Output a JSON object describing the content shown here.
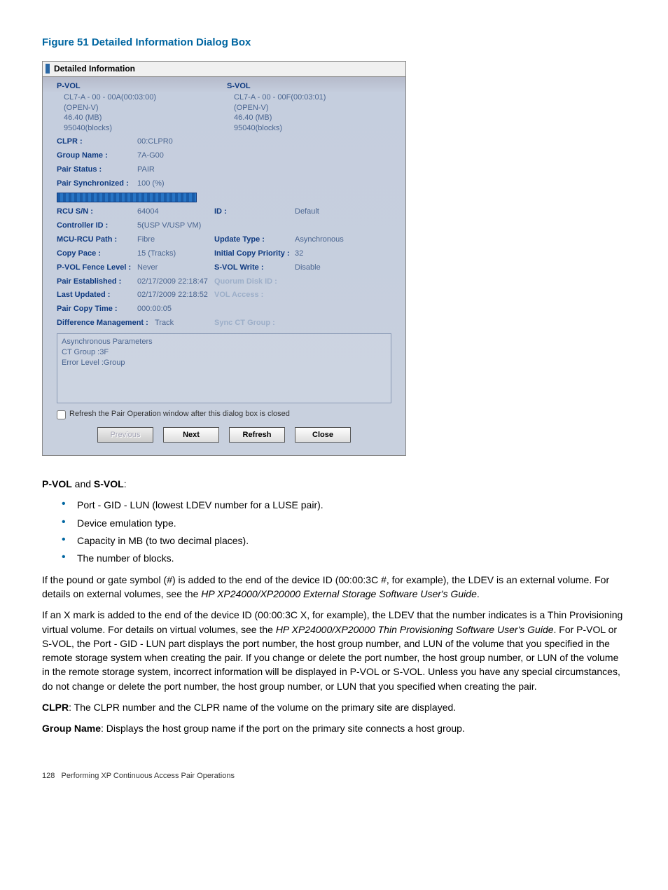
{
  "figure_caption": "Figure 51 Detailed Information Dialog Box",
  "dialog": {
    "title": "Detailed Information",
    "pvol": {
      "label": "P-VOL",
      "line1": "CL7-A - 00 - 00A(00:03:00)",
      "line2": "(OPEN-V)",
      "line3": "46.40 (MB)",
      "line4": "95040(blocks)"
    },
    "svol": {
      "label": "S-VOL",
      "line1": "CL7-A - 00 - 00F(00:03:01)",
      "line2": "(OPEN-V)",
      "line3": "46.40 (MB)",
      "line4": "95040(blocks)"
    },
    "rows": {
      "clpr_label": "CLPR :",
      "clpr_val": "00:CLPR0",
      "group_name_label": "Group Name :",
      "group_name_val": "7A-G00",
      "pair_status_label": "Pair Status :",
      "pair_status_val": "PAIR",
      "pair_sync_label": "Pair Synchronized :",
      "pair_sync_val": "100 (%)",
      "rcu_sn_label": "RCU S/N :",
      "rcu_sn_val": "64004",
      "id_label": "ID :",
      "id_val": "Default",
      "controller_label": "Controller ID :",
      "controller_val": "5(USP V/USP VM)",
      "mcu_rcu_label": "MCU-RCU Path :",
      "mcu_rcu_val": "Fibre",
      "update_type_label": "Update Type :",
      "update_type_val": "Asynchronous",
      "copy_pace_label": "Copy Pace :",
      "copy_pace_val": "15 (Tracks)",
      "initial_copy_label": "Initial Copy Priority :",
      "initial_copy_val": "32",
      "fence_label": "P-VOL Fence Level :",
      "fence_val": "Never",
      "svol_write_label": "S-VOL Write :",
      "svol_write_val": "Disable",
      "pair_est_label": "Pair Established :",
      "pair_est_val": "02/17/2009 22:18:47",
      "quorum_label": "Quorum Disk ID :",
      "last_upd_label": "Last Updated :",
      "last_upd_val": "02/17/2009 22:18:52",
      "vol_access_label": "VOL Access :",
      "pair_copy_label": "Pair Copy Time :",
      "pair_copy_val": "000:00:05",
      "diff_mgmt_label": "Difference Management :",
      "diff_mgmt_val": "Track",
      "sync_ct_label": "Sync CT Group :"
    },
    "async_box": {
      "line1": "Asynchronous Parameters",
      "line2": "CT Group :3F",
      "line3": "Error Level :Group"
    },
    "checkbox_label": "Refresh the Pair Operation window after this dialog box is closed",
    "buttons": {
      "previous": "Previous",
      "next": "Next",
      "refresh": "Refresh",
      "close": "Close"
    }
  },
  "doc": {
    "heading1": "P-VOL",
    "heading1_and": " and ",
    "heading1_b": "S-VOL",
    "heading1_colon": ":",
    "bullets": [
      "Port - GID - LUN (lowest LDEV number for a LUSE pair).",
      "Device emulation type.",
      "Capacity in MB (to two decimal places).",
      "The number of blocks."
    ],
    "para1a": "If the pound or gate symbol (#) is added to the end of the device ID (00:00:3C #, for example), the LDEV is an external volume. For details on external volumes, see the ",
    "para1b": "HP XP24000/XP20000 External Storage Software User's Guide",
    "para1c": ".",
    "para2a": "If an X mark is added to the end of the device ID (00:00:3C X, for example), the LDEV that the number indicates is a Thin Provisioning virtual volume. For details on virtual volumes, see the ",
    "para2b": "HP XP24000/XP20000 Thin Provisioning Software User's Guide",
    "para2c": ". For P-VOL or S-VOL, the Port - GID - LUN part displays the port number, the host group number, and LUN of the volume that you specified in the remote storage system when creating the pair. If you change or delete the port number, the host group number, or LUN of the volume in the remote storage system, incorrect information will be displayed in P-VOL or S-VOL. Unless you have any special circumstances, do not change or delete the port number, the host group number, or LUN that you specified when creating the pair.",
    "para3a": "CLPR",
    "para3b": ": The CLPR number and the CLPR name of the volume on the primary site are displayed.",
    "para4a": "Group Name",
    "para4b": ": Displays the host group name if the port on the primary site connects a host group.",
    "footer_page": "128",
    "footer_text": "Performing XP Continuous Access Pair Operations"
  }
}
